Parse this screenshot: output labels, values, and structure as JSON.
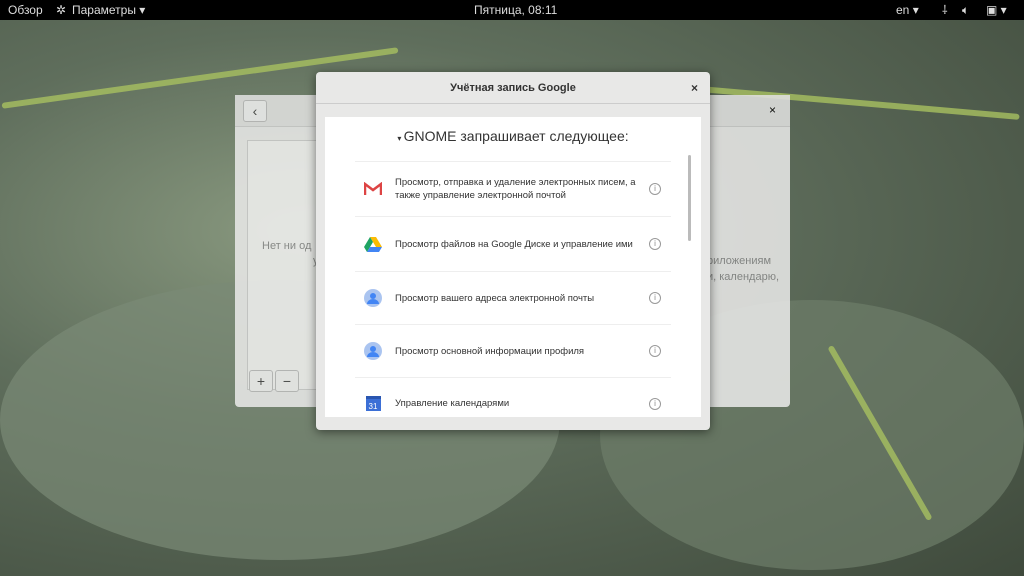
{
  "topbar": {
    "overview": "Обзор",
    "app_menu": "Параметры",
    "clock": "Пятница, 08:11",
    "language": "en"
  },
  "background_window": {
    "empty_text": "Нет ни од",
    "empty_text2": "у",
    "right_text1": "риложениям",
    "right_text2": "и, календарю,",
    "add": "+",
    "remove": "−"
  },
  "dialog": {
    "title": "Учётная запись Google",
    "close": "×",
    "request_heading": "GNOME запрашивает следующее:",
    "permissions": [
      {
        "icon": "gmail-icon",
        "text": "Просмотр, отправка и удаление электронных писем, а также управление электронной почтой"
      },
      {
        "icon": "google-drive-icon",
        "text": "Просмотр файлов на Google Диске и управление ими"
      },
      {
        "icon": "user-icon",
        "text": "Просмотр вашего адреса электронной почты"
      },
      {
        "icon": "user-icon",
        "text": "Просмотр основной информации профиля"
      },
      {
        "icon": "calendar-icon",
        "text": "Управление календарями",
        "calendar_day": "31"
      }
    ]
  }
}
